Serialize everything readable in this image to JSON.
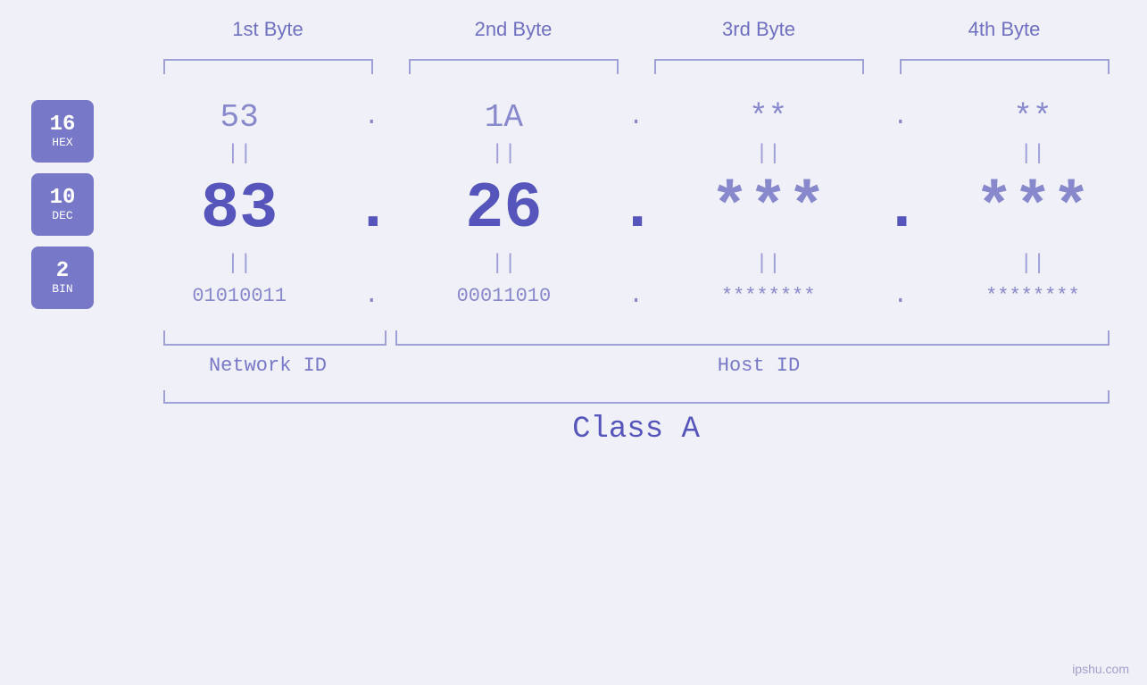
{
  "bytes": {
    "headers": [
      "1st Byte",
      "2nd Byte",
      "3rd Byte",
      "4th Byte"
    ]
  },
  "badges": [
    {
      "number": "16",
      "label": "HEX"
    },
    {
      "number": "10",
      "label": "DEC"
    },
    {
      "number": "2",
      "label": "BIN"
    }
  ],
  "hex_values": [
    "53",
    "1A",
    "**",
    "**"
  ],
  "dec_values": [
    "83",
    "26",
    "***",
    "***"
  ],
  "bin_values": [
    "01010011",
    "00011010",
    "********",
    "********"
  ],
  "separators": [
    ".",
    ".",
    ".",
    ""
  ],
  "labels": {
    "network_id": "Network ID",
    "host_id": "Host ID",
    "class": "Class A"
  },
  "watermark": "ipshu.com",
  "equals": "||"
}
